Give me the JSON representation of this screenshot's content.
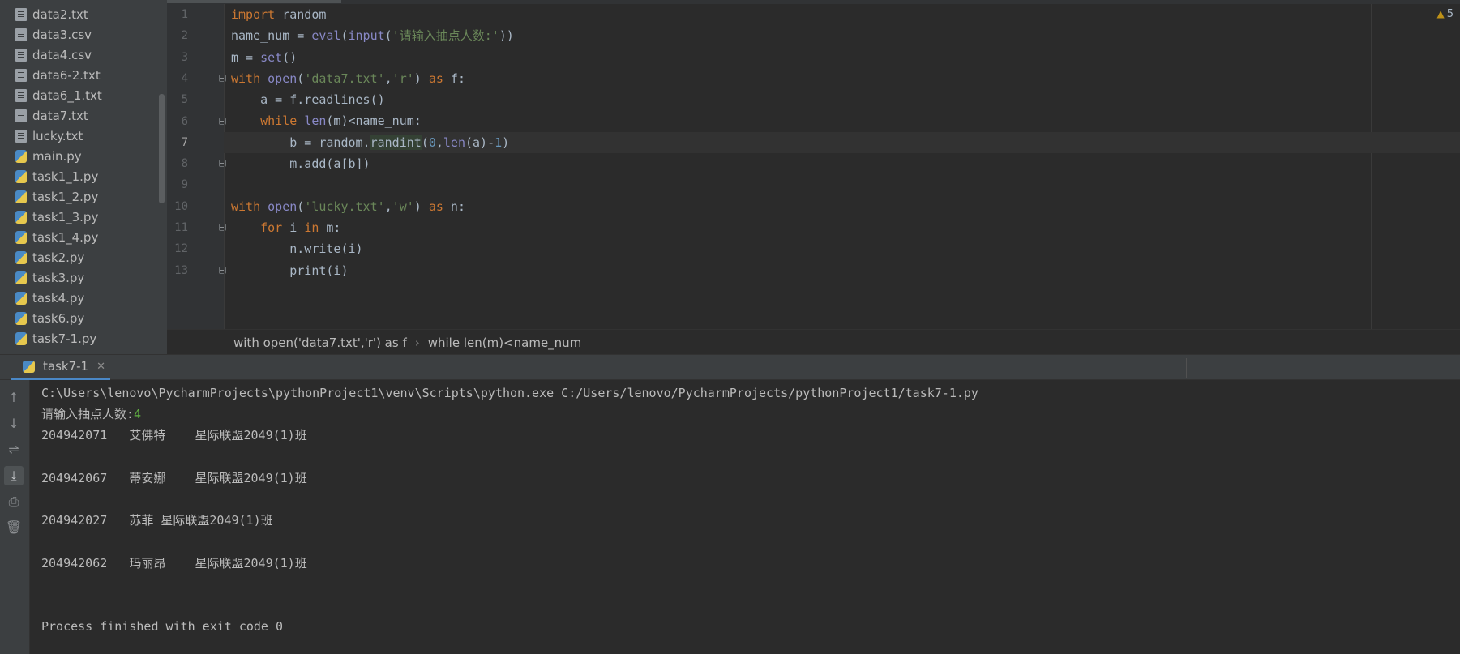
{
  "project_tree": {
    "items": [
      {
        "label": "data2.txt",
        "type": "txt"
      },
      {
        "label": "data3.csv",
        "type": "txt"
      },
      {
        "label": "data4.csv",
        "type": "txt"
      },
      {
        "label": "data6-2.txt",
        "type": "txt"
      },
      {
        "label": "data6_1.txt",
        "type": "txt"
      },
      {
        "label": "data7.txt",
        "type": "txt"
      },
      {
        "label": "lucky.txt",
        "type": "txt"
      },
      {
        "label": "main.py",
        "type": "py"
      },
      {
        "label": "task1_1.py",
        "type": "py"
      },
      {
        "label": "task1_2.py",
        "type": "py"
      },
      {
        "label": "task1_3.py",
        "type": "py"
      },
      {
        "label": "task1_4.py",
        "type": "py"
      },
      {
        "label": "task2.py",
        "type": "py"
      },
      {
        "label": "task3.py",
        "type": "py"
      },
      {
        "label": "task4.py",
        "type": "py"
      },
      {
        "label": "task6.py",
        "type": "py"
      },
      {
        "label": "task7-1.py",
        "type": "py"
      }
    ]
  },
  "editor": {
    "line_numbers": [
      "1",
      "2",
      "3",
      "4",
      "5",
      "6",
      "7",
      "8",
      "9",
      "10",
      "11",
      "12",
      "13"
    ],
    "current_line": 7,
    "warnings_count": "5",
    "lines": [
      "import random",
      "name_num = eval(input('请输入抽点人数:'))",
      "m = set()",
      "with open('data7.txt','r') as f:",
      "    a = f.readlines()",
      "    while len(m)<name_num:",
      "        b = random.randint(0,len(a)-1)",
      "        m.add(a[b])",
      "",
      "with open('lucky.txt','w') as n:",
      "    for i in m:",
      "        n.write(i)",
      "        print(i)"
    ],
    "breadcrumb": [
      "with open('data7.txt','r') as f",
      "while len(m)<name_num"
    ]
  },
  "run_panel": {
    "tab_label": "task7-1",
    "command": "C:\\Users\\lenovo\\PycharmProjects\\pythonProject1\\venv\\Scripts\\python.exe C:/Users/lenovo/PycharmProjects/pythonProject1/task7-1.py",
    "prompt": "请输入抽点人数:",
    "input_value": "4",
    "output_lines": [
      "204942071   艾佛特    星际联盟2049(1)班",
      "",
      "204942067   蒂安娜    星际联盟2049(1)班",
      "",
      "204942027   苏菲 星际联盟2049(1)班",
      "",
      "204942062   玛丽昂    星际联盟2049(1)班",
      "",
      ""
    ],
    "exit_message": "Process finished with exit code 0"
  },
  "colors": {
    "background": "#2b2b2b",
    "keyword": "#cc7832",
    "string": "#6a8759",
    "number": "#6897bb",
    "builtin": "#8888c6",
    "input_value": "#62b543",
    "tab_underline": "#4a88c7"
  }
}
